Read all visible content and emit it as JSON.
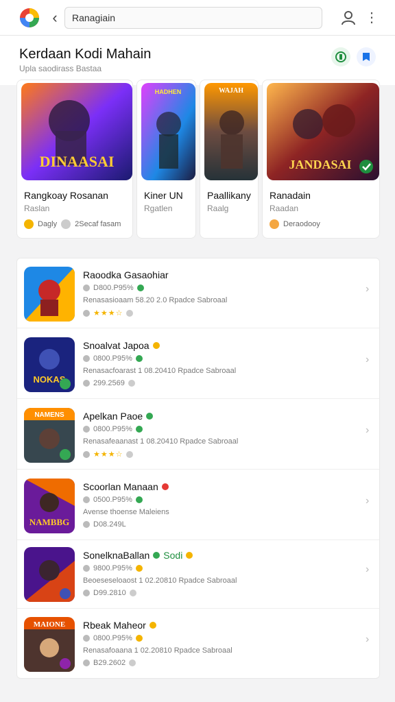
{
  "header": {
    "search_value": "Ranagiain",
    "icons": [
      "app-logo",
      "back-arrow",
      "user-icon",
      "more-vert-icon"
    ]
  },
  "hero": {
    "title": "Kerdaan Kodi Mahain",
    "subtitle": "Upla saodirass Bastaa",
    "buttons": [
      "chat-icon",
      "bookmark-icon"
    ]
  },
  "featured": [
    {
      "title": "Rangkoay Rosanan",
      "sub": "Raslan",
      "meta1": "Dagly",
      "meta2": "2Secaf fasam",
      "art_text": "DINAASAI"
    },
    {
      "title": "Kiner UN",
      "sub": "Rgatlen",
      "art_text": "HADHEN"
    },
    {
      "title": "Paallikany",
      "sub": "Raalg",
      "art_text": "WAJAH"
    },
    {
      "title": "Ranadain",
      "sub": "Raadan",
      "meta1": "Deraodooy",
      "art_text": "JANDASAI"
    }
  ],
  "list": [
    {
      "title": "Raoodka Gasaohiar",
      "l1": "D800.P95%",
      "l2": "Renasasioaam 58.20 2.0 Rpadce Sabroaal",
      "l3": "★★★☆",
      "badge": "green"
    },
    {
      "title": "Snoalvat Japoa",
      "l1": "0800.P95%",
      "l2": "Renasacfoarast 1 08.20410 Rpadce Sabroaal",
      "l3": "299.2569",
      "badge": "yellow",
      "art_text": "NOKAS"
    },
    {
      "title": "Apelkan Paoe",
      "l1": "0800.P95%",
      "l2": "Renasafeaanast 1 08.20410 Rpadce Sabroaal",
      "l3": "★★★☆",
      "badge": "green",
      "art_text": "NAMENS"
    },
    {
      "title": "Scoorlan Manaan",
      "l1": "0500.P95%",
      "l2": "Avense thoense Maleiens",
      "l3": "D08.249L",
      "badge": "red",
      "art_text": "NAMBBG"
    },
    {
      "title": "SonelknaBallan",
      "l1": "9800.P95%",
      "l2": "Beoeseseloaost 1 02.20810 Rpadce Sabroaal",
      "l3": "D99.2810",
      "badge": "green",
      "extra": "Sodi"
    },
    {
      "title": "Rbeak Maheor",
      "l1": "0800.P95%",
      "l2": "Renasafoaana 1 02.20810 Rpadce Sabroaal",
      "l3": "B29.2602",
      "badge": "yellow",
      "art_text": "MAIONE"
    }
  ]
}
